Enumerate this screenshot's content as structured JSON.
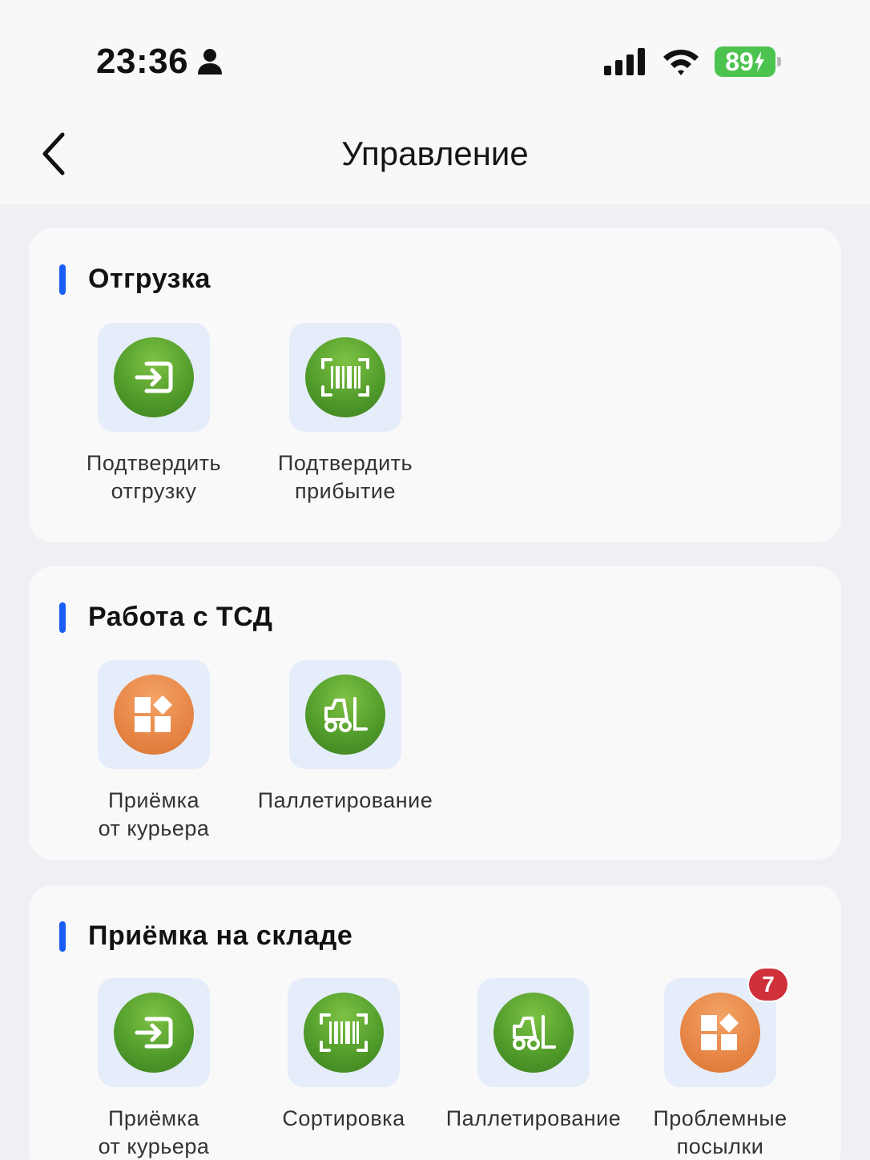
{
  "status_bar": {
    "time": "23:36",
    "battery": "89"
  },
  "header": {
    "title": "Управление"
  },
  "sections": [
    {
      "title": "Отгрузка",
      "items": [
        {
          "label_line1": "Подтвердить",
          "label_line2": "отгрузку",
          "icon": "login-arrow-icon"
        },
        {
          "label_line1": "Подтвердить",
          "label_line2": "прибытие",
          "icon": "barcode-scan-icon"
        }
      ]
    },
    {
      "title": "Работа с ТСД",
      "items": [
        {
          "label_line1": "Приёмка",
          "label_line2": "от курьера",
          "icon": "apps-blocks-icon"
        },
        {
          "label_line1": "Паллетирование",
          "label_line2": "",
          "icon": "forklift-icon"
        }
      ]
    },
    {
      "title": "Приёмка на складе",
      "items": [
        {
          "label_line1": "Приёмка",
          "label_line2": "от курьера",
          "icon": "login-arrow-icon"
        },
        {
          "label_line1": "Сортировка",
          "label_line2": "",
          "icon": "barcode-scan-icon"
        },
        {
          "label_line1": "Паллетирование",
          "label_line2": "",
          "icon": "forklift-icon"
        },
        {
          "label_line1": "Проблемные",
          "label_line2": "посылки",
          "icon": "apps-blocks-icon",
          "badge": "7"
        }
      ]
    }
  ],
  "colors": {
    "accent_bar": "#1a5cf5",
    "green": "#4f9a2a",
    "orange": "#e68545",
    "badge": "#d0303a",
    "tile_bg": "#e5edfa"
  }
}
